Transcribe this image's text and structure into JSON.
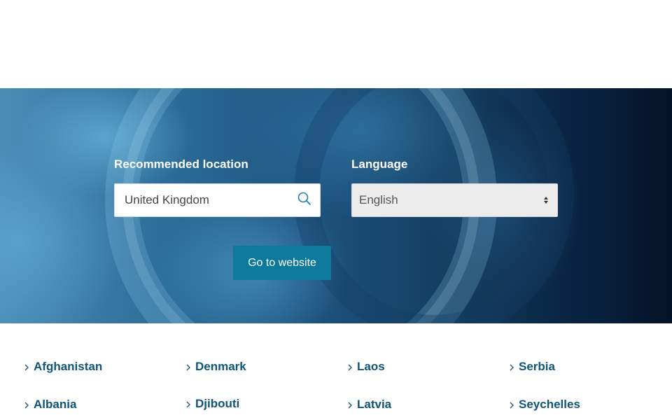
{
  "form": {
    "location_label": "Recommended location",
    "location_value": "United Kingdom",
    "language_label": "Language",
    "language_selected": "English",
    "submit_label": "Go to website"
  },
  "icons": {
    "search": "search-icon",
    "select": "select-arrows-icon",
    "chevron": "chevron-right-icon"
  },
  "colors": {
    "button_bg": "#0d7a9c",
    "link_text": "#0f5578",
    "label_text": "#ffffff"
  },
  "countries": {
    "col1": [
      "Afghanistan",
      "Albania"
    ],
    "col2": [
      "Denmark",
      "Djibouti"
    ],
    "col3": [
      "Laos",
      "Latvia"
    ],
    "col4": [
      "Serbia",
      "Seychelles"
    ]
  }
}
